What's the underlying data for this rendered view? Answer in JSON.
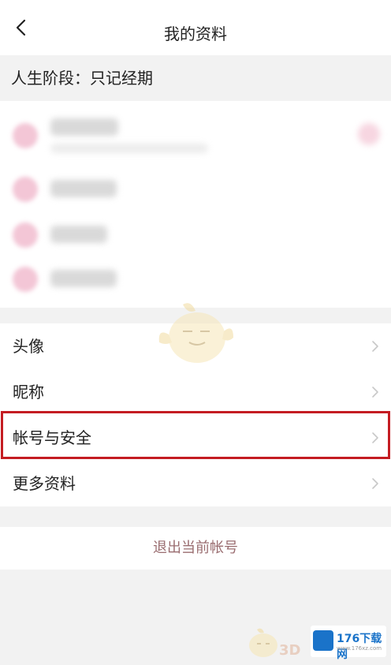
{
  "header": {
    "title": "我的资料",
    "back_icon": "chevron-left-icon"
  },
  "stage": {
    "text": "人生阶段：只记经期"
  },
  "menu": {
    "items": [
      {
        "label": "头像",
        "icon": "chevron-right-icon"
      },
      {
        "label": "昵称",
        "icon": "chevron-right-icon"
      },
      {
        "label": "帐号与安全",
        "icon": "chevron-right-icon"
      },
      {
        "label": "更多资料",
        "icon": "chevron-right-icon"
      }
    ]
  },
  "logout": {
    "label": "退出当前帐号"
  },
  "watermark": {
    "brand": "176下载网",
    "url": "www.176xz.com",
    "tag": "3D"
  },
  "colors": {
    "highlight": "#c41c22",
    "logout_text": "#9a6d70",
    "background": "#f2f2f2",
    "blurred_accent": "#f3c6d6"
  }
}
